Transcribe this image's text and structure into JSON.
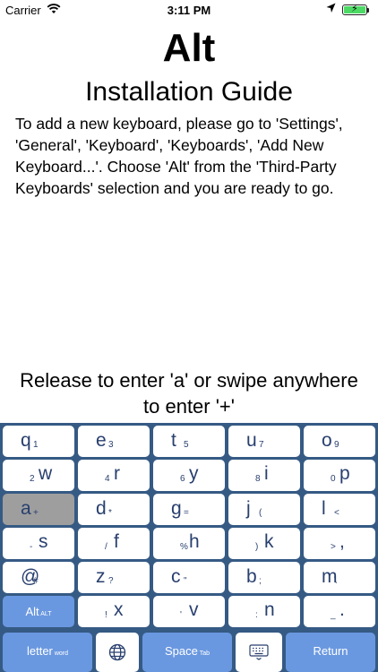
{
  "status_bar": {
    "carrier": "Carrier",
    "time": "3:11 PM",
    "battery_color": "#4cd964",
    "icons": [
      "wifi-icon",
      "location-icon",
      "battery-charging-icon"
    ]
  },
  "header": {
    "title": "Alt",
    "subtitle": "Installation Guide"
  },
  "instructions": "To add a new keyboard, please go to 'Settings', 'General', 'Keyboard', 'Keyboards', 'Add New Keyboard...'. Choose 'Alt' from the 'Third-Party Keyboards' selection and you are ready to go.",
  "hint": "Release to enter 'a' or swipe anywhere to enter '+'",
  "keyboard": {
    "colors": {
      "background": "#355a84",
      "key": "#ffffff",
      "key_text": "#283f6e",
      "highlight": "#9e9e9e",
      "function_key": "#6a98e0"
    },
    "rows": [
      [
        {
          "main": "q",
          "alt": "1"
        },
        {
          "main": "e",
          "alt": "3"
        },
        {
          "main": "t",
          "alt": "5"
        },
        {
          "main": "u",
          "alt": "7"
        },
        {
          "main": "o",
          "alt": "9"
        }
      ],
      [
        {
          "main": "w",
          "alt": "2"
        },
        {
          "main": "r",
          "alt": "4"
        },
        {
          "main": "y",
          "alt": "6"
        },
        {
          "main": "i",
          "alt": "8"
        },
        {
          "main": "p",
          "alt": "0"
        }
      ],
      [
        {
          "main": "a",
          "alt": "+"
        },
        {
          "main": "d",
          "alt": "*"
        },
        {
          "main": "g",
          "alt": "="
        },
        {
          "main": "j",
          "alt": "("
        },
        {
          "main": "l",
          "alt": "<"
        }
      ],
      [
        {
          "main": "s",
          "alt": "-"
        },
        {
          "main": "f",
          "alt": "/"
        },
        {
          "main": "h",
          "alt": "%"
        },
        {
          "main": "k",
          "alt": ")"
        },
        {
          "main": ",",
          "alt": ">"
        }
      ],
      [
        {
          "main": "@",
          "alt": "#"
        },
        {
          "main": "z",
          "alt": "?"
        },
        {
          "main": "c",
          "alt": "\""
        },
        {
          "main": "b",
          "alt": ";"
        },
        {
          "main": "m",
          "alt": "\\"
        }
      ],
      [
        {
          "main": "x",
          "alt": "!"
        },
        {
          "main": "v",
          "alt": "'"
        },
        {
          "main": "n",
          "alt": ":"
        },
        {
          "main": ".",
          "alt": "_"
        }
      ]
    ],
    "highlighted_key": "a",
    "alt_key": {
      "label": "Alt",
      "sub": "ALT"
    },
    "bottom_row": {
      "letter": {
        "label": "letter",
        "sub": "word"
      },
      "globe_icon": "globe-icon",
      "space": {
        "label": "Space",
        "sub": "Tab"
      },
      "keyboard_icon": "keyboard-icon",
      "return": {
        "label": "Return"
      }
    }
  }
}
